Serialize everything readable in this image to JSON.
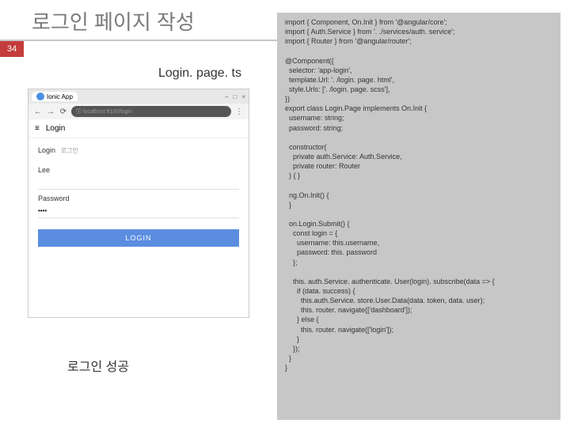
{
  "title": "로그인 페이지 작성",
  "slide_number": "34",
  "file_label": "Login. page. ts",
  "success_text": "로그인 성공",
  "browser": {
    "tab_label": "Ionic App",
    "address": "localhost:8100/login",
    "app_header_icon": "≡",
    "app_header": "Login",
    "login_label": "Login",
    "login_sub": "로그인",
    "user_label": "Lee",
    "pass_label": "Password",
    "pass_value": "••••",
    "button": "LOGIN"
  },
  "code": "import { Component, On.Init } from '@angular/core';\nimport { Auth.Service } from '. ./services/auth. service';\nimport { Router } from '@angular/router';\n\n@Component({\n  selector: 'app-login',\n  template.Url: '. /login. page. html',\n  style.Urls: ['. /login. page. scss'],\n})\nexport class Login.Page implements On.Init {\n  username: string;\n  password: string;\n\n  constructor(\n    private auth.Service: Auth.Service,\n    private router: Router\n  ) { }\n\n  ng.On.Init() {\n  }\n\n  on.Login.Submit() {\n    const login = {\n      username: this.username,\n      password: this. password\n    };\n\n    this. auth.Service. authenticate. User(login). subscribe(data => {\n      if (data. success) {\n        this.auth.Service. store.User.Data(data. token, data. user);\n        this. router. navigate(['dashboard']);\n      } else {\n        this. router. navigate(['login']);\n      }\n    });\n  }\n}"
}
